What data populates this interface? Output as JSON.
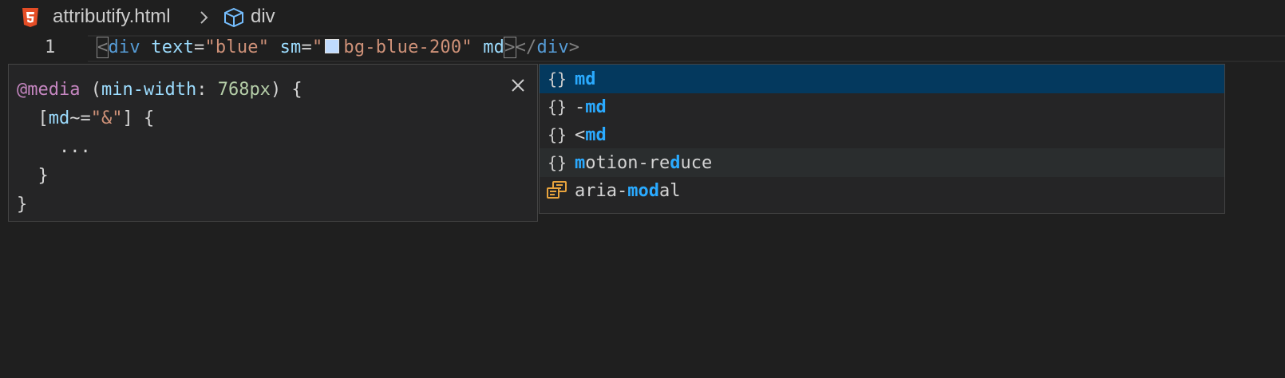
{
  "breadcrumb": {
    "file_icon": "html5-icon",
    "file_name": "attributify.html",
    "separator_icon": "chevron-right-icon",
    "symbol_icon": "cube-icon",
    "symbol_name": "div"
  },
  "editor": {
    "line_number": "1",
    "code": {
      "open_lt": "<",
      "tag": "div",
      "attr1_name": "text",
      "eq": "=",
      "attr1_value": "\"blue\"",
      "attr2_name": "sm",
      "attr2_value_open": "\"",
      "attr2_value_text": "bg-blue-200",
      "attr2_value_close": "\"",
      "attr3_name": "md",
      "open_gt": ">",
      "close_tag": "</div>"
    },
    "swatch_color": "#bfdbfe"
  },
  "detail_panel": {
    "close_icon": "close-icon",
    "lines": {
      "at_rule": "@media",
      "paren_open": "(",
      "feature": "min-width",
      "colon": ":",
      "value": "768px",
      "paren_close_brace": ") {",
      "selector_open": "[",
      "selector_attr": "md",
      "selector_op": "~=",
      "selector_value": "\"&\"",
      "selector_close_brace": "] {",
      "ellipsis": "...",
      "inner_close": "}",
      "outer_close": "}"
    }
  },
  "suggestions": [
    {
      "icon": "braces-icon",
      "icon_glyph": "{}",
      "pre": "",
      "match": "md",
      "post": "",
      "state": "selected"
    },
    {
      "icon": "braces-icon",
      "icon_glyph": "{}",
      "pre": "-",
      "match": "md",
      "post": "",
      "state": ""
    },
    {
      "icon": "braces-icon",
      "icon_glyph": "{}",
      "pre": "<",
      "match": "md",
      "post": "",
      "state": ""
    },
    {
      "icon": "braces-icon",
      "icon_glyph": "{}",
      "parts": [
        [
          "m",
          true
        ],
        [
          "otion-re",
          false
        ],
        [
          "d",
          true
        ],
        [
          "uce",
          false
        ]
      ],
      "state": "hovered"
    },
    {
      "icon": "property-icon",
      "icon_glyph": "",
      "parts": [
        [
          "aria-",
          false
        ],
        [
          "mo",
          true
        ],
        [
          "d",
          true
        ],
        [
          "al",
          false
        ]
      ],
      "state": ""
    }
  ]
}
